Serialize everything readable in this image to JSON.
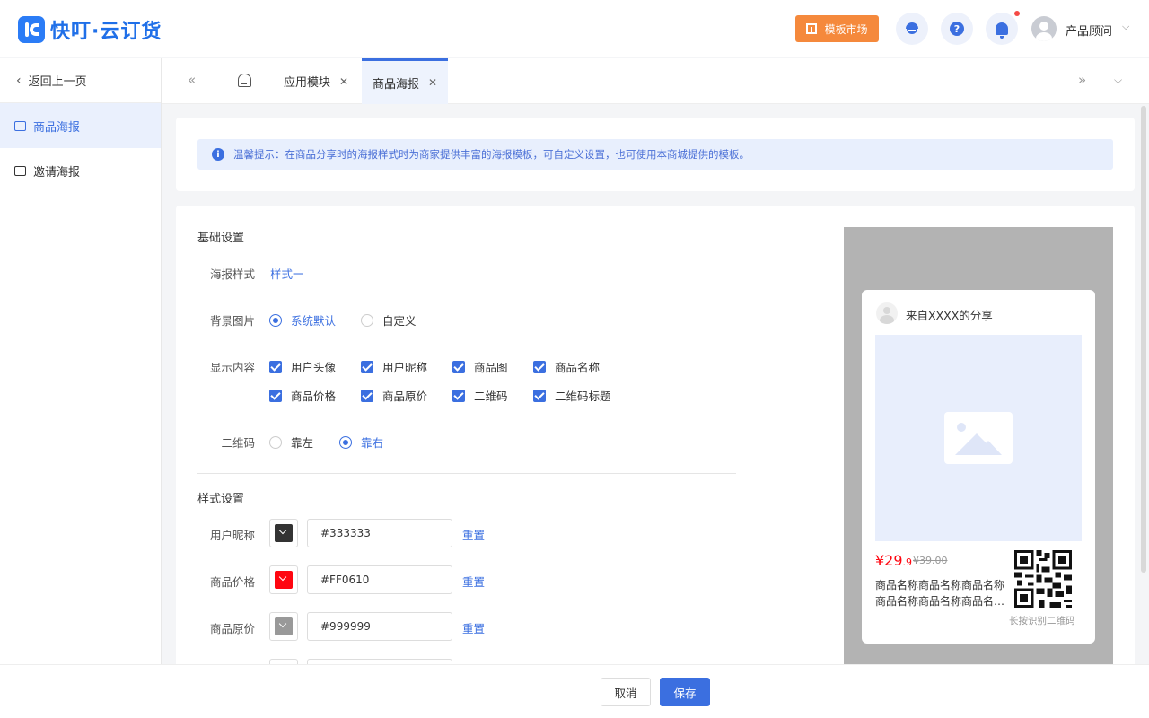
{
  "header": {
    "brand": "快叮·云订货",
    "market_label": "模板市场",
    "user_name": "产品顾问",
    "help_glyph": "?"
  },
  "sidebar": {
    "back_label": "返回上一页",
    "items": [
      {
        "label": "商品海报",
        "active": true,
        "icon": "bag-icon"
      },
      {
        "label": "邀请海报",
        "active": false,
        "icon": "image-icon"
      }
    ]
  },
  "tabs": [
    {
      "label": "应用模块",
      "active": false
    },
    {
      "label": "商品海报",
      "active": true
    }
  ],
  "notice": {
    "text": "温馨提示：在商品分享时的海报样式时为商家提供丰富的海报模板，可自定义设置，也可使用本商城提供的模板。",
    "icon_glyph": "i"
  },
  "basic": {
    "title": "基础设置",
    "style_label": "海报样式",
    "style_value": "样式一",
    "bg_label": "背景图片",
    "bg_options": [
      {
        "label": "系统默认",
        "selected": true
      },
      {
        "label": "自定义",
        "selected": false
      }
    ],
    "display_label": "显示内容",
    "display_options": [
      {
        "label": "用户头像",
        "checked": true
      },
      {
        "label": "用户昵称",
        "checked": true
      },
      {
        "label": "商品图",
        "checked": true
      },
      {
        "label": "商品名称",
        "checked": true
      },
      {
        "label": "商品价格",
        "checked": true
      },
      {
        "label": "商品原价",
        "checked": true
      },
      {
        "label": "二维码",
        "checked": true
      },
      {
        "label": "二维码标题",
        "checked": true
      }
    ],
    "qr_label": "二维码",
    "qr_options": [
      {
        "label": "靠左",
        "selected": false
      },
      {
        "label": "靠右",
        "selected": true
      }
    ]
  },
  "style": {
    "title": "样式设置",
    "reset_label": "重置",
    "rows": [
      {
        "label": "用户昵称",
        "value": "#333333",
        "color": "#333333"
      },
      {
        "label": "商品价格",
        "value": "#FF0610",
        "color": "#FF0610"
      },
      {
        "label": "商品原价",
        "value": "#999999",
        "color": "#999999"
      }
    ]
  },
  "preview": {
    "from_text": "来自XXXX的分享",
    "price_main": "¥29",
    "price_decimal": ".9",
    "original_price": "¥39.00",
    "name_line1": "商品名称商品名称商品名称",
    "name_line2": "商品名称商品名称商品名称商品名称",
    "qr_caption": "长按识别二维码"
  },
  "footer": {
    "cancel": "取消",
    "save": "保存"
  },
  "colors": {
    "accent": "#3b6fe0",
    "market": "#f5893c",
    "price": "#FF0610"
  }
}
